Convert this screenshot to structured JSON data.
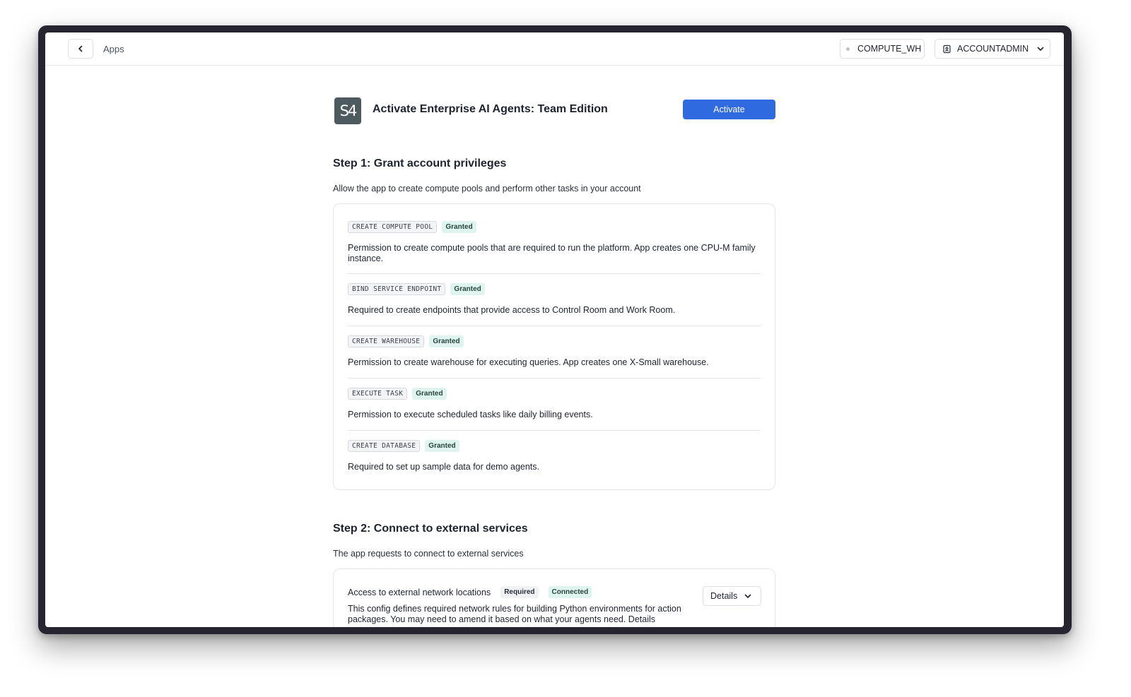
{
  "topbar": {
    "breadcrumb": "Apps",
    "warehouse": "COMPUTE_WH",
    "role": "ACCOUNTADMIN"
  },
  "app": {
    "logo_text": "S4",
    "title": "Activate Enterprise AI Agents: Team Edition",
    "activate_label": "Activate"
  },
  "step1": {
    "title": "Step 1: Grant account privileges",
    "description": "Allow the app to create compute pools and perform other tasks in your account",
    "privileges": [
      {
        "name": "CREATE COMPUTE POOL",
        "status": "Granted",
        "description": "Permission to create compute pools that are required to run the platform. App creates one CPU-M family instance."
      },
      {
        "name": "BIND SERVICE ENDPOINT",
        "status": "Granted",
        "description": "Required to create endpoints that provide access to Control Room and Work Room."
      },
      {
        "name": "CREATE WAREHOUSE",
        "status": "Granted",
        "description": "Permission to create warehouse for executing queries. App creates one X-Small warehouse."
      },
      {
        "name": "EXECUTE TASK",
        "status": "Granted",
        "description": "Permission to execute scheduled tasks like daily billing events."
      },
      {
        "name": "CREATE DATABASE",
        "status": "Granted",
        "description": "Required to set up sample data for demo agents."
      }
    ]
  },
  "step2": {
    "title": "Step 2: Connect to external services",
    "description": "The app requests to connect to external services",
    "service": {
      "title": "Access to external network locations",
      "badge_required": "Required",
      "badge_status": "Connected",
      "details_label": "Details",
      "description": "This config defines required network rules for building Python environments for action packages. You may need to amend it based on what your agents need. Details"
    }
  }
}
